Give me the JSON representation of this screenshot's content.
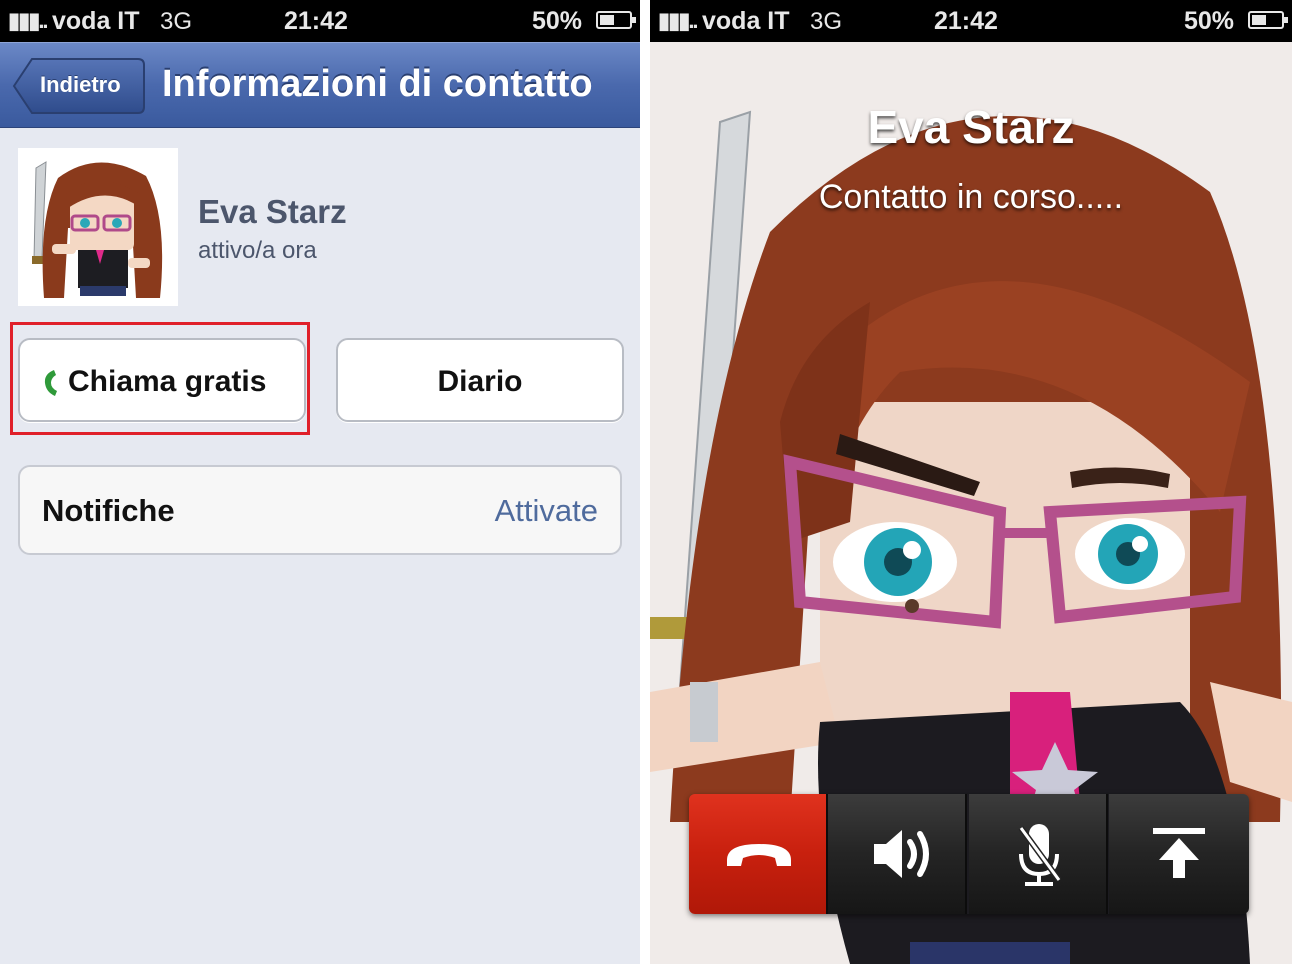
{
  "left_screen": {
    "status_bar": {
      "signal": "▮▮▮..",
      "carrier": "voda IT",
      "network": "3G",
      "time": "21:42",
      "battery": "50%"
    },
    "nav": {
      "back_label": "Indietro",
      "title": "Informazioni di contatto"
    },
    "contact": {
      "name": "Eva Starz",
      "status": "attivo/a ora"
    },
    "actions": {
      "call_label": "Chiama gratis",
      "diary_label": "Diario"
    },
    "notifications": {
      "label": "Notifiche",
      "value": "Attivate"
    },
    "colors": {
      "nav_blue": "#4a69ad",
      "highlight_red": "#e0202a",
      "link_blue": "#4f6b9d",
      "background": "#e6e9f1"
    }
  },
  "right_screen": {
    "status_bar": {
      "signal": "▮▮▮..",
      "carrier": "voda IT",
      "network": "3G",
      "time": "21:42",
      "battery": "50%"
    },
    "call": {
      "name": "Eva Starz",
      "status": "Contatto in corso....."
    },
    "controls": [
      "end-call-icon",
      "speaker-icon",
      "mute-microphone-icon",
      "share-upload-icon"
    ],
    "colors": {
      "end_call_red": "#c8200e",
      "control_dark": "#242424"
    }
  }
}
